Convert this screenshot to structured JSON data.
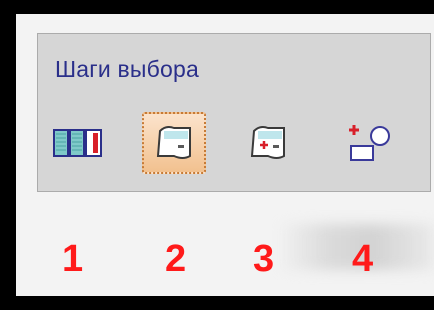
{
  "panel": {
    "title": "Шаги выбора",
    "tools": [
      {
        "icon": "multiple-panels-icon",
        "active": false
      },
      {
        "icon": "pick-element-icon",
        "active": true
      },
      {
        "icon": "add-to-selection-icon",
        "active": false
      },
      {
        "icon": "add-shapes-icon",
        "active": false
      }
    ]
  },
  "steps": [
    "1",
    "2",
    "3",
    "4"
  ],
  "colors": {
    "accent_red": "#ff1a1a",
    "title_blue": "#2a2f8a",
    "active_fill": "#f2c18f"
  }
}
